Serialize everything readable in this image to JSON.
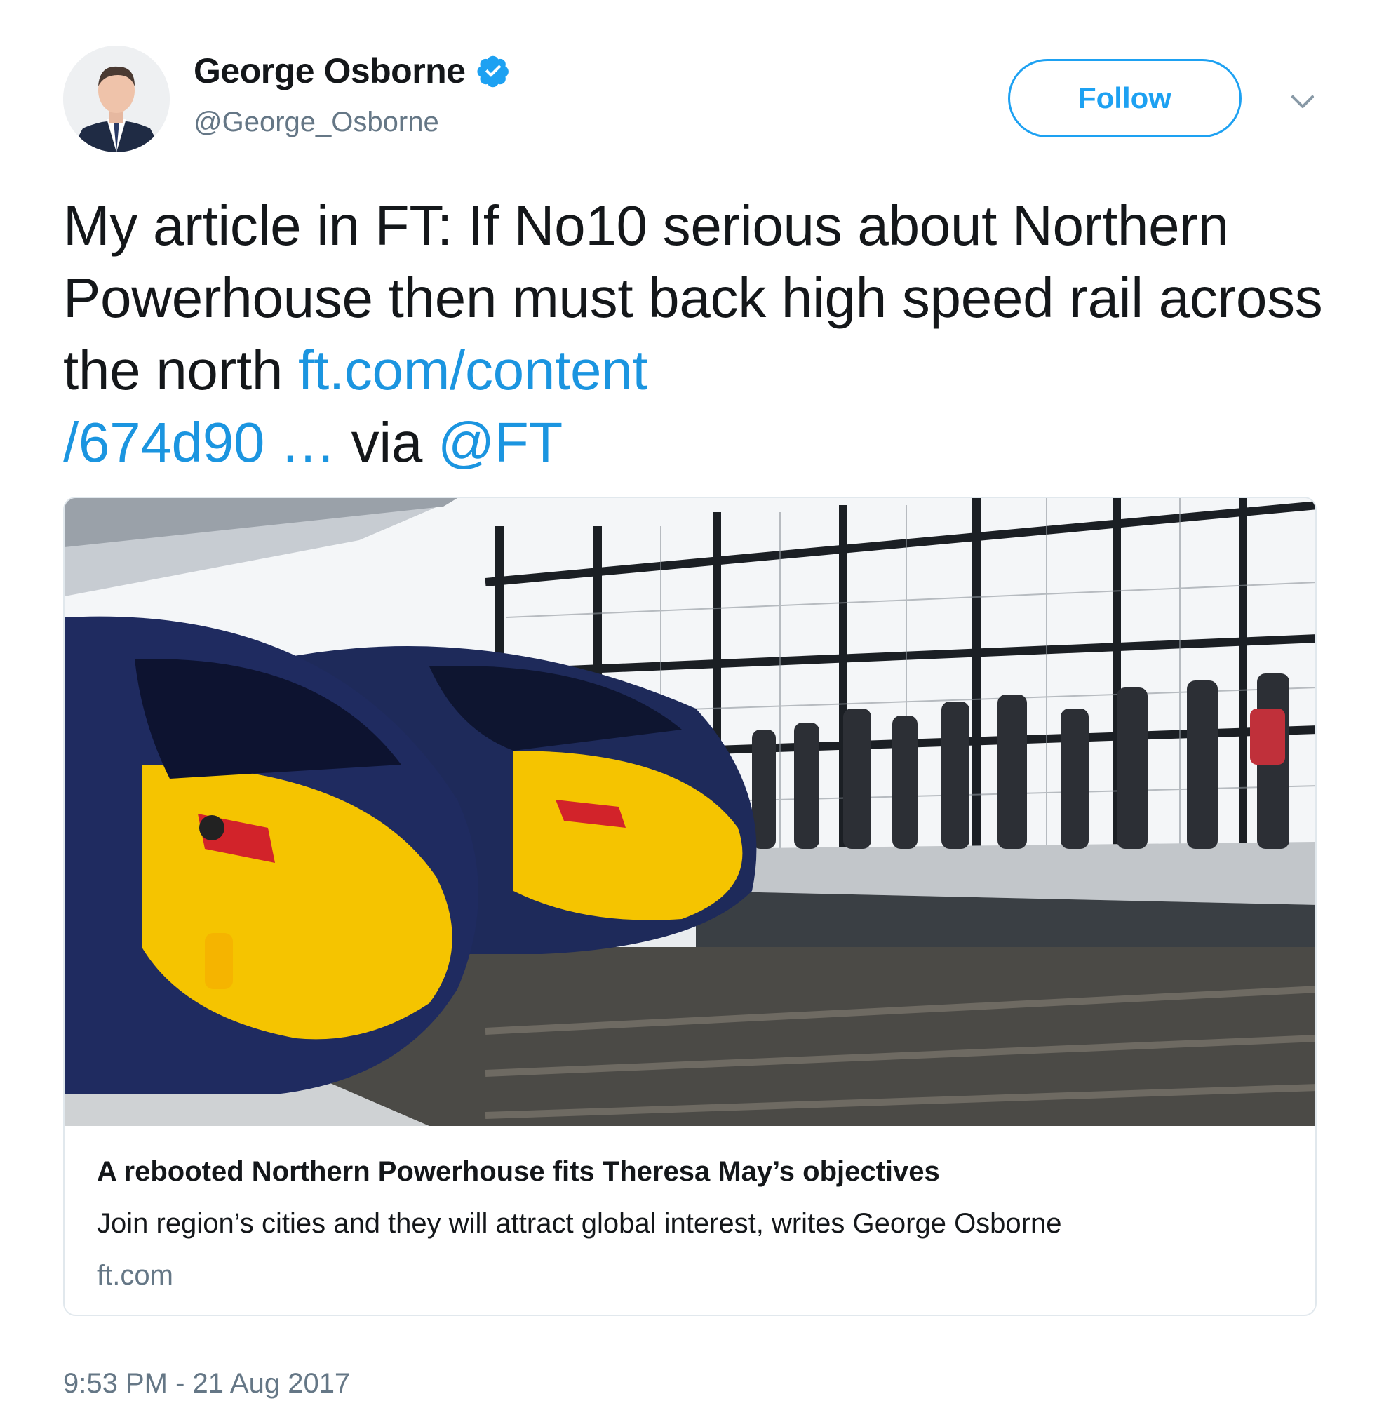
{
  "author": {
    "name": "George Osborne",
    "handle": "@George_Osborne",
    "verified": true,
    "avatar_icon": "profile-photo-man-in-suit",
    "verified_icon": "verified-badge-icon"
  },
  "actions": {
    "follow_label": "Follow",
    "menu_icon": "chevron-down-icon"
  },
  "tweet": {
    "text_part1": "My article in FT: If No10 serious about Northern Powerhouse then must back high speed rail across the north ",
    "link_line1": "ft.com/content",
    "link_line2": "/674d90 …",
    "text_via": " via ",
    "mention": "@FT"
  },
  "card": {
    "image_description_icon": "high-speed-trains-at-platform-photo",
    "title": "A rebooted Northern Powerhouse fits Theresa May’s objectives",
    "description": "Join region’s cities and they will attract global interest, writes George Osborne",
    "domain": "ft.com"
  },
  "timestamp": "9:53 PM - 21 Aug 2017",
  "colors": {
    "link": "#1b95e0",
    "follow_accent": "#1da1f2",
    "muted_text": "#657786",
    "card_border": "#e1e8ed",
    "train_yellow": "#f5c400",
    "train_blue": "#1e2a5a"
  }
}
